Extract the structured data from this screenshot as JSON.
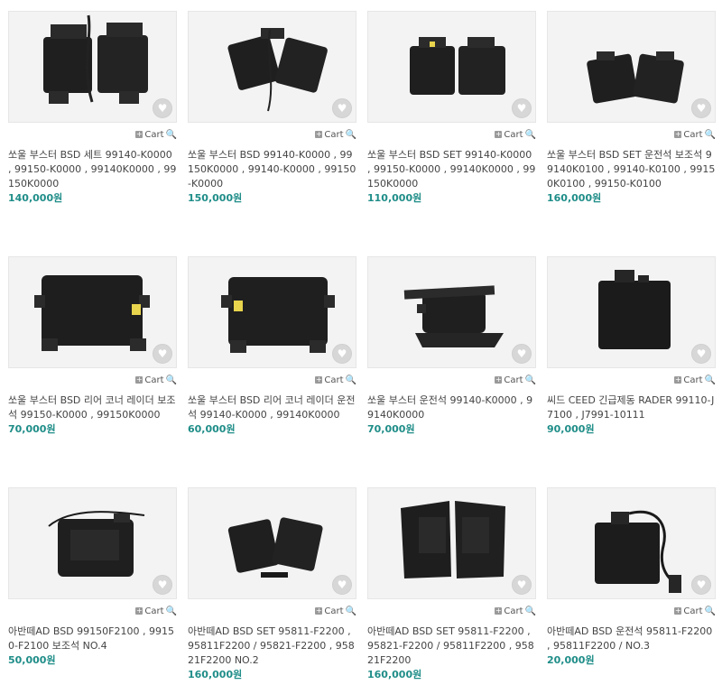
{
  "products": [
    {
      "name": "쏘울 부스터 BSD 세트 99140-K0000 , 99150-K0000 , 99140K0000 , 99150K0000",
      "price": "140,000원",
      "cart_label": "Cart"
    },
    {
      "name": "쏘울 부스터 BSD 99140-K0000 , 99150K0000 , 99140-K0000 , 99150-K0000",
      "price": "150,000원",
      "cart_label": "Cart"
    },
    {
      "name": "쏘울 부스터 BSD SET 99140-K0000 , 99150-K0000 , 99140K0000 , 99150K0000",
      "price": "110,000원",
      "cart_label": "Cart"
    },
    {
      "name": "쏘울 부스터 BSD SET 운전석 보조석 99140K0100 , 99140-K0100 , 99150K0100 , 99150-K0100",
      "price": "160,000원",
      "cart_label": "Cart"
    },
    {
      "name": "쏘울 부스터 BSD 리어 코너 레이더 보조석 99150-K0000 , 99150K0000",
      "price": "70,000원",
      "cart_label": "Cart"
    },
    {
      "name": "쏘울 부스터 BSD 리어 코너 레이더 운전석 99140-K0000 , 99140K0000",
      "price": "60,000원",
      "cart_label": "Cart"
    },
    {
      "name": "쏘울 부스터 운전석 99140-K0000 , 99140K0000",
      "price": "70,000원",
      "cart_label": "Cart"
    },
    {
      "name": "씨드 CEED 긴급제동 RADER 99110-J7100 , J7991-10111",
      "price": "90,000원",
      "cart_label": "Cart"
    },
    {
      "name": "아반떼AD BSD 99150F2100 , 99150-F2100 보조석 NO.4",
      "price": "50,000원",
      "cart_label": "Cart"
    },
    {
      "name": "아반떼AD BSD SET 95811-F2200 , 95811F2200 / 95821-F2200 , 95821F2200 NO.2",
      "price": "160,000원",
      "cart_label": "Cart"
    },
    {
      "name": "아반떼AD BSD SET 95811-F2200 , 95821-F2200 / 95811F2200 , 95821F2200",
      "price": "160,000원",
      "cart_label": "Cart"
    },
    {
      "name": "아반떼AD BSD 운전석 95811-F2200 , 95811F2200 / NO.3",
      "price": "20,000원",
      "cart_label": "Cart"
    }
  ],
  "icons": {
    "wishlist": "heart-icon",
    "cart_add": "plus-icon",
    "cart_view": "magnifier-icon"
  },
  "colors": {
    "price": "#1f8d88",
    "thumb_bg": "#f3f3f3",
    "heart_bg": "#d7d7d7"
  }
}
